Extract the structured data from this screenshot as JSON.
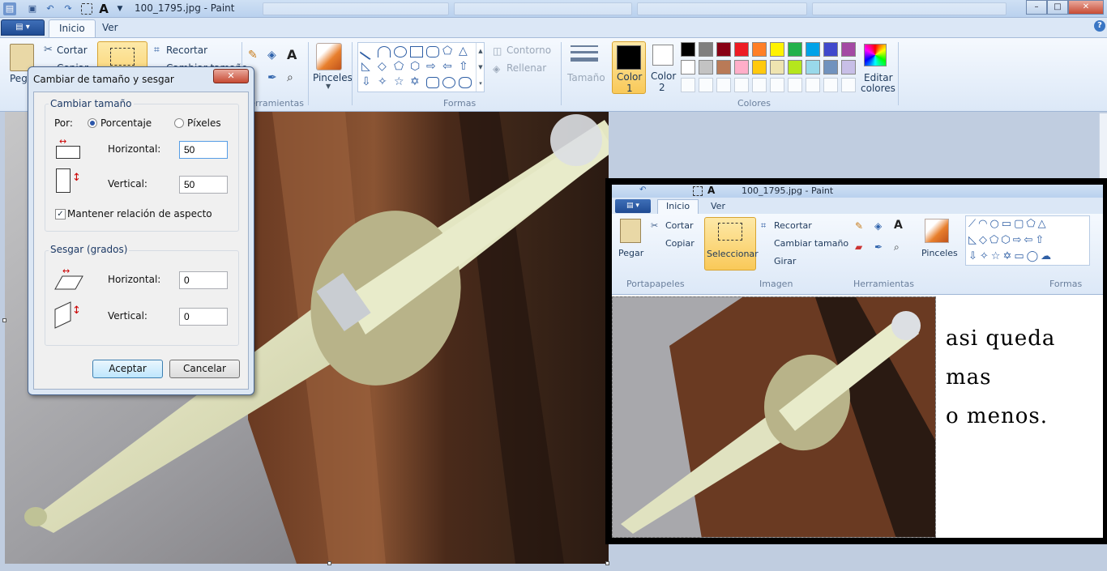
{
  "window": {
    "title": "100_1795.jpg - Paint",
    "help": "?",
    "minimize": "–",
    "maximize": "□",
    "close": "✕"
  },
  "ribbon": {
    "tabs": [
      "Inicio",
      "Ver"
    ],
    "clipboard": {
      "paste": "Pegar",
      "cut": "Cortar",
      "copy": "Copiar"
    },
    "image": {
      "crop": "Recortar",
      "resize": "Cambiar tamaño",
      "rotate": "Girar",
      "select": "Seleccionar"
    },
    "tools_label": "Herramientas",
    "brushes": "Pinceles",
    "shapes": {
      "outline": "Contorno",
      "fill": "Rellenar",
      "label": "Formas"
    },
    "size": "Tamaño",
    "color1": {
      "label": "Color",
      "num": "1",
      "value": "#000000"
    },
    "color2": {
      "label": "Color",
      "num": "2",
      "value": "#ffffff"
    },
    "colors_label": "Colores",
    "edit_colors": {
      "line1": "Editar",
      "line2": "colores"
    },
    "palette_row1": [
      "#000000",
      "#7f7f7f",
      "#880015",
      "#ed1c24",
      "#ff7f27",
      "#fff200",
      "#22b14c",
      "#00a2e8",
      "#3f48cc",
      "#a349a4"
    ],
    "palette_row2": [
      "#ffffff",
      "#c3c3c3",
      "#b97a57",
      "#ffaec9",
      "#ffc90e",
      "#efe4b0",
      "#b5e61d",
      "#99d9ea",
      "#7092be",
      "#c8bfe7"
    ]
  },
  "dialog": {
    "title": "Cambiar de tamaño y sesgar",
    "close": "✕",
    "resize": {
      "legend": "Cambiar tamaño",
      "by": "Por:",
      "percent": "Porcentaje",
      "pixels": "Píxeles",
      "horizontal_label": "Horizontal:",
      "horizontal_value": "50",
      "vertical_label": "Vertical:",
      "vertical_value": "50",
      "keep_aspect": "Mantener relación de aspecto"
    },
    "skew": {
      "legend": "Sesgar (grados)",
      "horizontal_label": "Horizontal:",
      "horizontal_value": "0",
      "vertical_label": "Vertical:",
      "vertical_value": "0"
    },
    "ok": "Aceptar",
    "cancel": "Cancelar"
  },
  "overlay": {
    "title": "100_1795.jpg - Paint",
    "tabs": [
      "Inicio",
      "Ver"
    ],
    "paste": "Pegar",
    "cut": "Cortar",
    "copy": "Copiar",
    "select": "Seleccionar",
    "crop": "Recortar",
    "resize": "Cambiar tamaño",
    "rotate": "Girar",
    "brushes": "Pinceles",
    "group_clipboard": "Portapapeles",
    "group_image": "Imagen",
    "group_tools": "Herramientas",
    "group_shapes": "Formas",
    "note_line1": "asi queda mas",
    "note_line2": "o menos."
  }
}
